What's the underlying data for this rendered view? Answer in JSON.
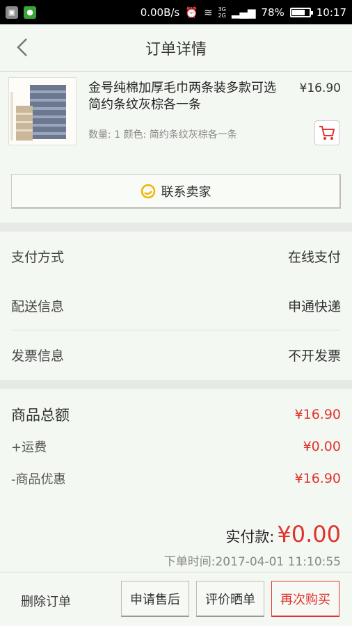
{
  "statusbar": {
    "net_speed": "0.00B/s",
    "net_type_top": "3G",
    "net_type_bottom": "2G",
    "battery": "78%",
    "battery_level": 0.78,
    "time": "10:17"
  },
  "nav": {
    "title": "订单详情"
  },
  "product": {
    "title": "金号纯棉加厚毛巾两条装多款可选 简约条纹灰棕各一条",
    "price": "¥16.90",
    "spec": "数量: 1 颜色: 简约条纹灰棕各一条"
  },
  "contact": {
    "label": "联系卖家"
  },
  "info": {
    "payment_label": "支付方式",
    "payment_value": "在线支付",
    "delivery_label": "配送信息",
    "delivery_value": "申通快递",
    "invoice_label": "发票信息",
    "invoice_value": "不开发票"
  },
  "totals": {
    "goods_label": "商品总额",
    "goods_value": "¥16.90",
    "shipping_label": "+运费",
    "shipping_value": "¥0.00",
    "discount_label": "-商品优惠",
    "discount_value": "¥16.90",
    "paid_label": "实付款:",
    "paid_value": "¥0.00",
    "order_time": "下单时间:2017-04-01 11:10:55"
  },
  "bottom": {
    "delete": "删除订单",
    "after_sale": "申请售后",
    "review": "评价晒单",
    "rebuy": "再次购买"
  },
  "colors": {
    "accent_red": "#e0342c",
    "bg": "#f4f8f2"
  }
}
